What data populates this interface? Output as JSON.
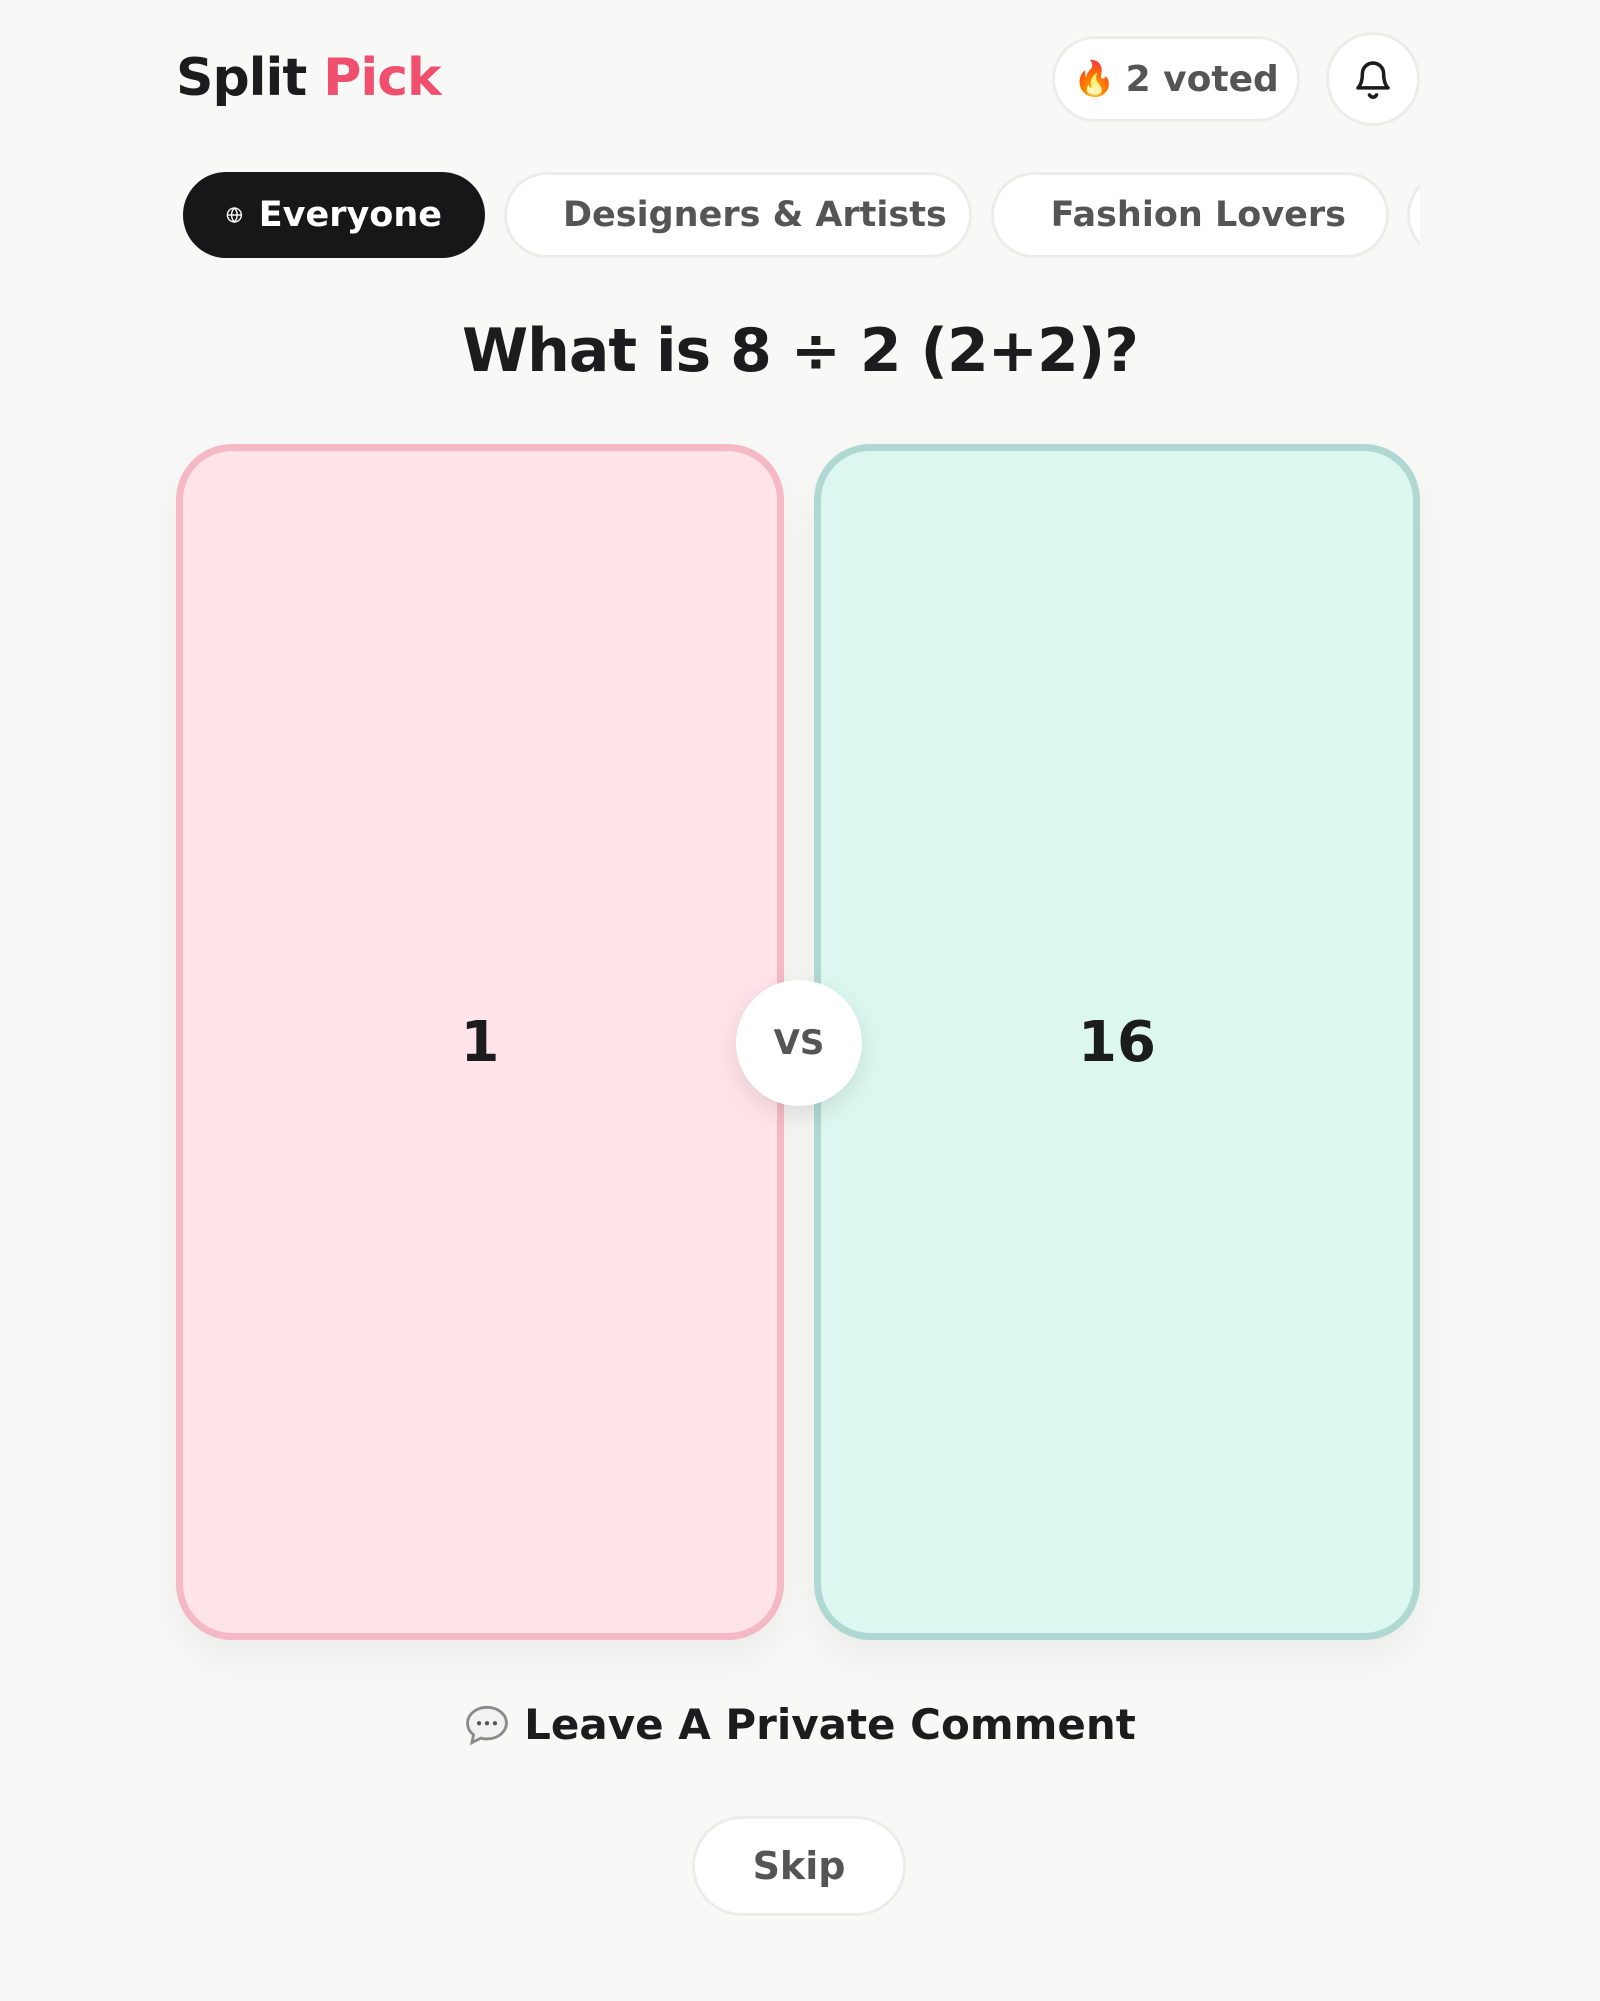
{
  "header": {
    "brand_primary": "Split",
    "brand_accent": "Pick",
    "voted_icon": "fire-emoji",
    "voted_label": "2 voted",
    "notifications_icon": "bell-icon"
  },
  "filters": [
    {
      "label": "Everyone",
      "icon": "globe-icon",
      "active": true
    },
    {
      "label": "Designers & Artists",
      "icon": "pencil-icon",
      "active": false
    },
    {
      "label": "Fashion Lovers",
      "icon": "hanger-icon",
      "active": false
    },
    {
      "label": "",
      "icon": "",
      "active": false
    }
  ],
  "question": "What is 8 ÷ 2 (2+2)?",
  "options": {
    "left": {
      "label": "1",
      "color": "#fee3e8",
      "border": "#f4b9c4"
    },
    "right": {
      "label": "16",
      "color": "#dcf6f0",
      "border": "#b0d8d2"
    },
    "vs_label": "VS"
  },
  "comment": {
    "icon": "speech-bubble-emoji",
    "label": "Leave A Private Comment"
  },
  "skip_label": "Skip",
  "colors": {
    "accent": "#f0506e",
    "dark": "#17171a",
    "background": "#f8f8f6"
  }
}
